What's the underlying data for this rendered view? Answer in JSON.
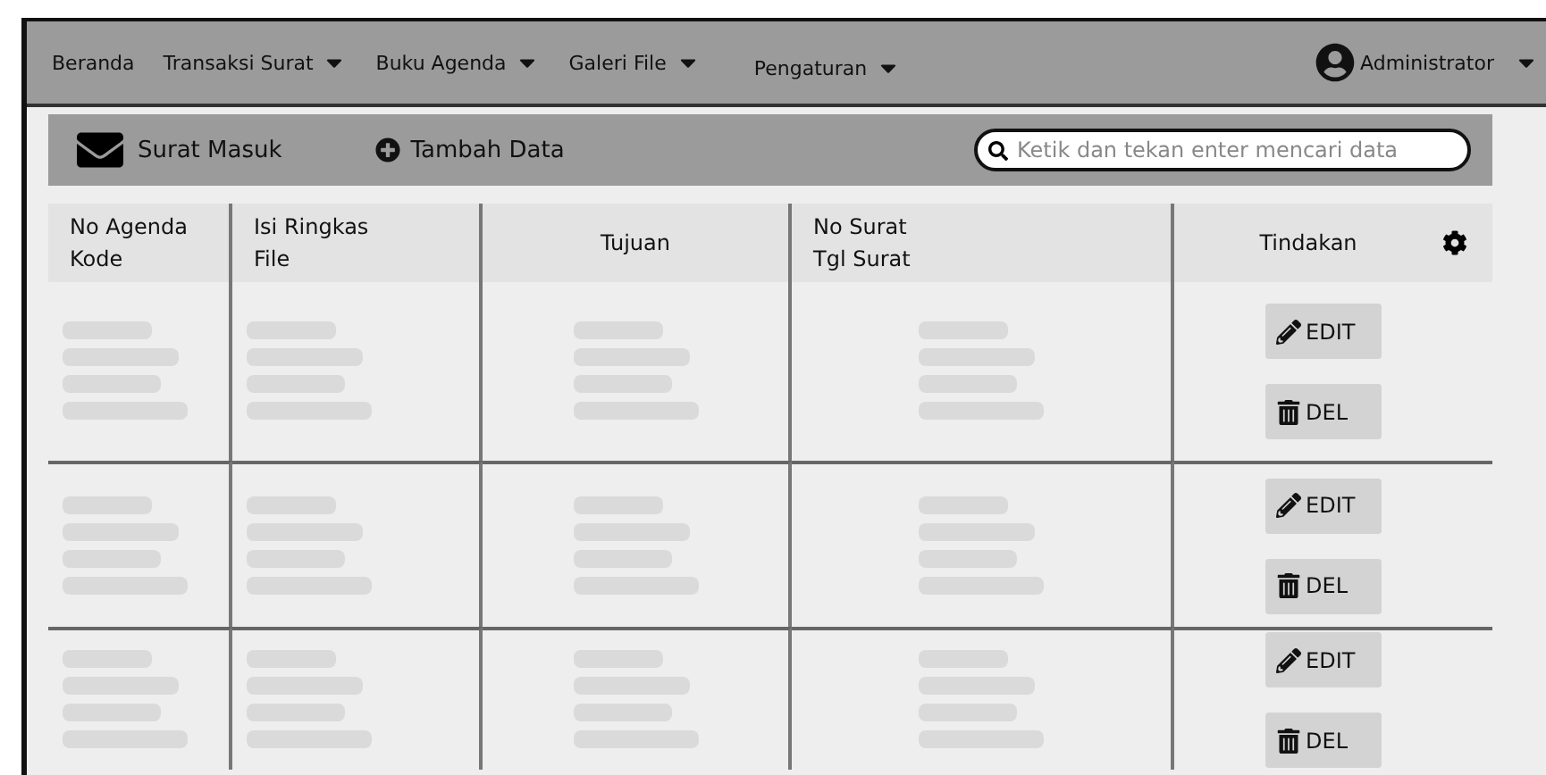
{
  "navbar": {
    "items": [
      {
        "label": "Beranda",
        "dropdown": false
      },
      {
        "label": "Transaksi Surat",
        "dropdown": true
      },
      {
        "label": "Buku Agenda",
        "dropdown": true
      },
      {
        "label": "Galeri File",
        "dropdown": true
      },
      {
        "label": "Pengaturan",
        "dropdown": true
      }
    ],
    "user": {
      "label": "Administrator",
      "dropdown": true
    }
  },
  "toolbar": {
    "title": "Surat Masuk",
    "add_button": "Tambah Data",
    "search": {
      "placeholder": "Ketik dan tekan enter mencari data"
    }
  },
  "table": {
    "columns": [
      {
        "lines": [
          "No Agenda",
          "Kode"
        ]
      },
      {
        "lines": [
          "Isi Ringkas",
          "File"
        ]
      },
      {
        "lines": [
          "Tujuan"
        ]
      },
      {
        "lines": [
          "No Surat",
          "Tgl Surat"
        ]
      },
      {
        "lines": [
          "Tindakan"
        ],
        "kind": "actions"
      }
    ],
    "rows": [
      {
        "actions": [
          {
            "kind": "edit",
            "label": "EDIT"
          },
          {
            "kind": "delete",
            "label": "DEL"
          }
        ]
      },
      {
        "actions": [
          {
            "kind": "edit",
            "label": "EDIT"
          },
          {
            "kind": "delete",
            "label": "DEL"
          }
        ]
      },
      {
        "actions": [
          {
            "kind": "edit",
            "label": "EDIT"
          },
          {
            "kind": "delete",
            "label": "DEL"
          }
        ]
      }
    ]
  }
}
